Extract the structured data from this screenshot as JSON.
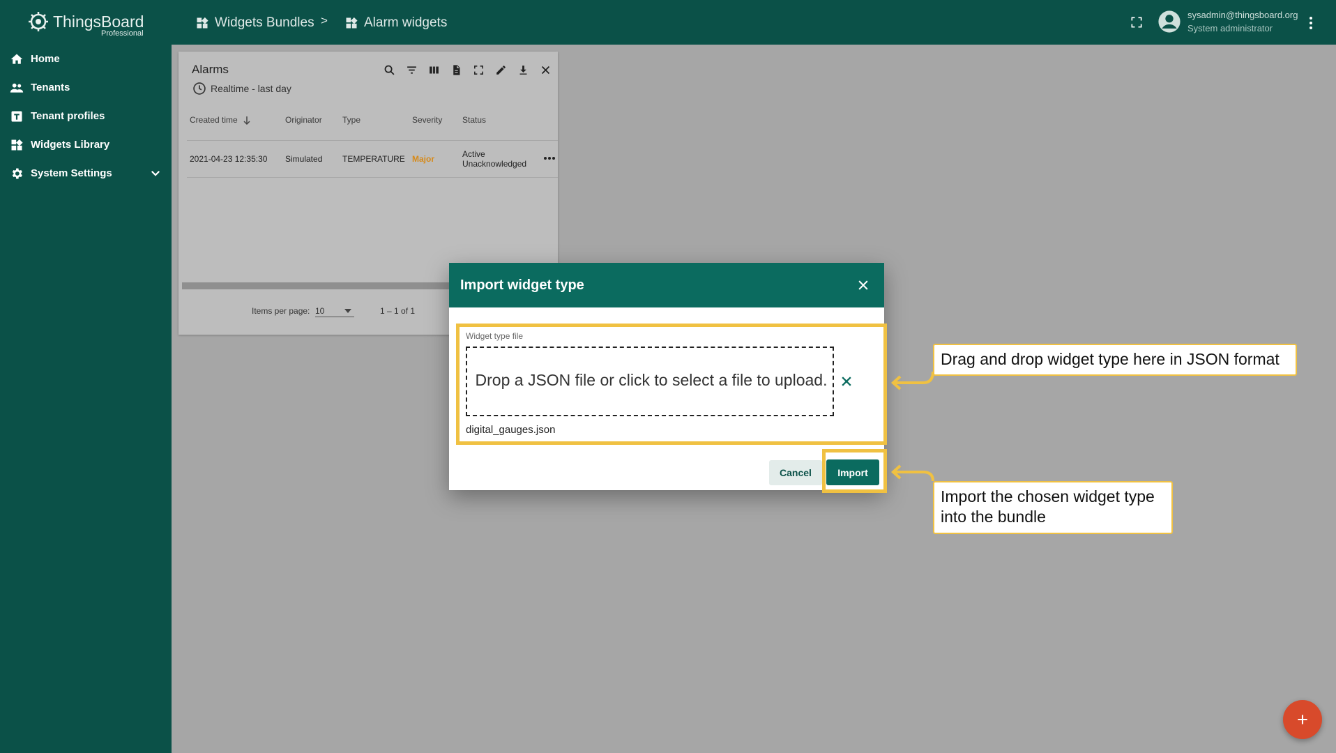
{
  "app": {
    "logo_name": "ThingsBoard",
    "logo_sub": "Professional"
  },
  "breadcrumb": {
    "items": [
      {
        "label": "Widgets Bundles",
        "icon": "widgets-icon"
      },
      {
        "label": "Alarm widgets",
        "icon": "widgets-icon"
      }
    ],
    "separator": ">"
  },
  "user": {
    "email": "sysadmin@thingsboard.org",
    "role": "System administrator"
  },
  "sidebar": {
    "items": [
      {
        "label": "Home",
        "icon": "home-icon"
      },
      {
        "label": "Tenants",
        "icon": "people-icon"
      },
      {
        "label": "Tenant profiles",
        "icon": "t-box-icon"
      },
      {
        "label": "Widgets Library",
        "icon": "widgets-icon"
      },
      {
        "label": "System Settings",
        "icon": "gear-icon"
      }
    ]
  },
  "widget": {
    "title": "Alarms",
    "timewindow": "Realtime - last day",
    "columns": [
      "Created time",
      "Originator",
      "Type",
      "Severity",
      "Status"
    ],
    "rows": [
      {
        "created": "2021-04-23 12:35:30",
        "originator": "Simulated",
        "type": "TEMPERATURE",
        "severity": "Major",
        "status_line1": "Active",
        "status_line2": "Unacknowledged"
      }
    ],
    "items_per_page_label": "Items per page:",
    "items_per_page": "10",
    "range": "1 – 1 of 1"
  },
  "dialog": {
    "title": "Import widget type",
    "file_label": "Widget type file",
    "dropzone_text": "Drop a JSON file or click to select a file to upload.",
    "file_name": "digital_gauges.json",
    "cancel_label": "Cancel",
    "import_label": "Import"
  },
  "callouts": {
    "drop": "Drag and drop widget type here in JSON format",
    "import": "Import the chosen widget type into the bundle"
  },
  "colors": {
    "primary": "#0b5148",
    "accent": "#0b6b5f",
    "highlight": "#f0c142",
    "severity_major": "#d68a1a",
    "fab": "#d84a2b"
  }
}
